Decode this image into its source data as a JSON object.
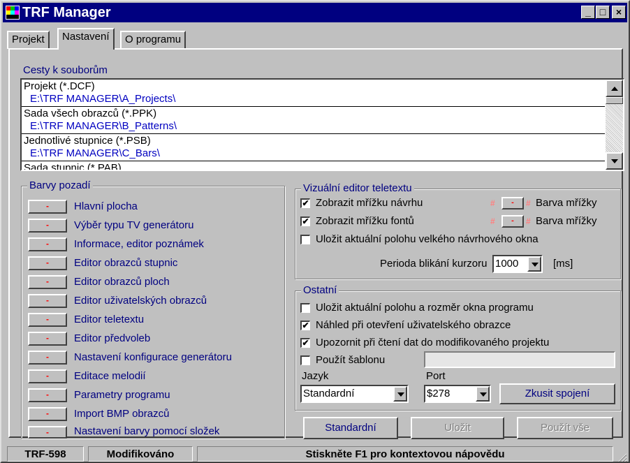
{
  "window": {
    "title": "TRF Manager"
  },
  "titlebar_buttons": {
    "minimize": "_",
    "maximize": "□",
    "close": "×"
  },
  "tabs": [
    {
      "label": "Projekt",
      "active": false
    },
    {
      "label": "Nastavení",
      "active": true
    },
    {
      "label": "O programu",
      "active": false
    }
  ],
  "paths_group": {
    "legend": "Cesty k souborům",
    "items": [
      {
        "name": "Projekt (*.DCF)",
        "path": "E:\\TRF MANAGER\\A_Projects\\"
      },
      {
        "name": "Sada všech obrazců (*.PPK)",
        "path": "E:\\TRF MANAGER\\B_Patterns\\"
      },
      {
        "name": "Jednotlivé stupnice (*.PSB)",
        "path": "E:\\TRF MANAGER\\C_Bars\\"
      },
      {
        "name": "Sada stupnic (*.PAB)",
        "path": ""
      }
    ]
  },
  "bg_colors": {
    "legend": "Barvy pozadí",
    "button_label": "-",
    "items": [
      "Hlavní plocha",
      "Výběr typu TV generátoru",
      "Informace, editor poznámek",
      "Editor obrazců stupnic",
      "Editor obrazců ploch",
      "Editor uživatelských obrazců",
      "Editor teletextu",
      "Editor předvoleb",
      "Nastavení konfigurace generátoru",
      "Editace melodií",
      "Parametry programu",
      "Import BMP obrazců",
      "Nastavení barvy pomocí složek"
    ]
  },
  "teletext": {
    "legend": "Vizuální editor teletextu",
    "show_grid_design": {
      "label": "Zobrazit mřížku návrhu",
      "checked": true
    },
    "show_grid_fonts": {
      "label": "Zobrazit mřížku fontů",
      "checked": true
    },
    "save_position": {
      "label": "Uložit aktuální polohu velkého návrhového okna",
      "checked": false
    },
    "grid_color_label": "Barva mřížky",
    "hash_glyph": "#",
    "blink_label": "Perioda blikání kurzoru",
    "blink_value": "1000",
    "blink_unit": "[ms]"
  },
  "other": {
    "legend": "Ostatní",
    "save_window": {
      "label": "Uložit aktuální polohu a rozměr okna programu",
      "checked": false
    },
    "preview": {
      "label": "Náhled při otevření uživatelského obrazce",
      "checked": true
    },
    "warn_modified": {
      "label": "Upozornit při čtení dat do modifikovaného projektu",
      "checked": true
    },
    "use_template": {
      "label": "Použít šablonu",
      "checked": false
    },
    "language_label": "Jazyk",
    "language_value": "Standardní",
    "port_label": "Port",
    "port_value": "$278",
    "try_connect": "Zkusit spojení"
  },
  "bottom_buttons": {
    "standard": "Standardní",
    "save": "Uložit",
    "apply_all": "Použít vše"
  },
  "status": {
    "device": "TRF-598",
    "state": "Modifikováno",
    "hint": "Stiskněte F1 pro kontextovou nápovědu"
  },
  "colors": {
    "titlebar": "#000080",
    "label_blue": "#000080",
    "path_blue": "#0000c0",
    "swatch_red": "#ff0000"
  }
}
